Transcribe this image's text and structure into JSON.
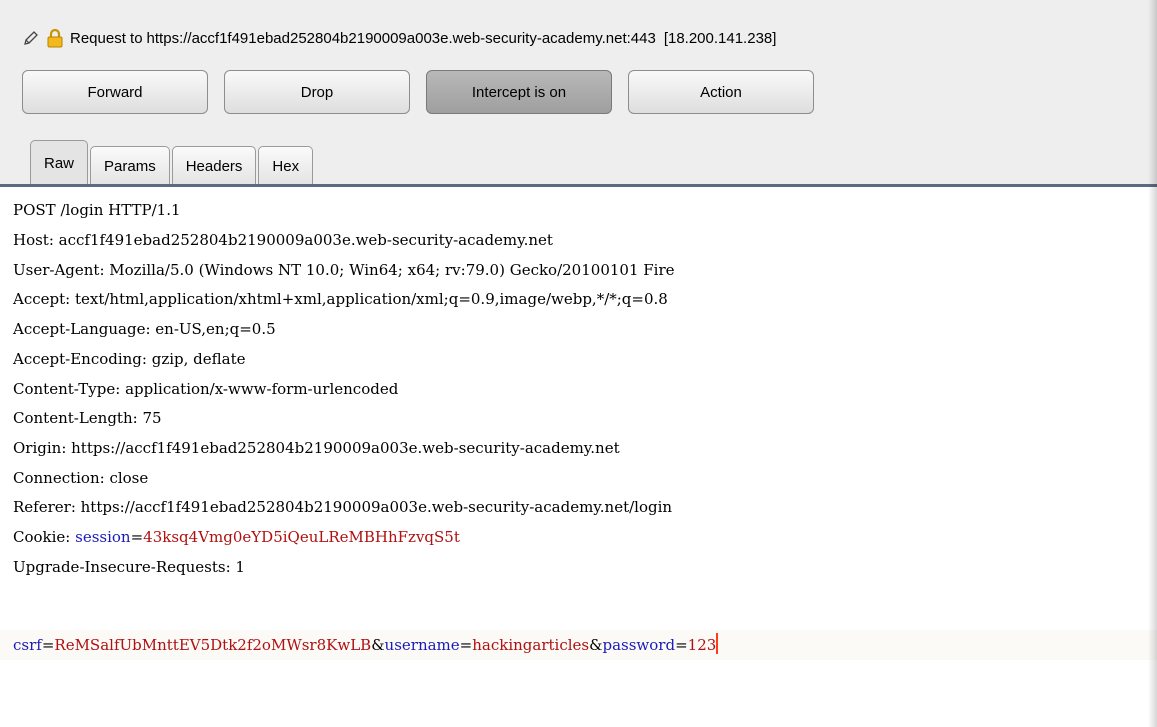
{
  "header": {
    "request_label": "Request to",
    "url": "https://accf1f491ebad252804b2190009a003e.web-security-academy.net:443",
    "ip": "[18.200.141.238]",
    "icons": [
      "pencil-icon",
      "lock-icon"
    ]
  },
  "buttons": {
    "forward": "Forward",
    "drop": "Drop",
    "intercept": "Intercept is on",
    "action": "Action"
  },
  "tabs": [
    {
      "label": "Raw",
      "active": true
    },
    {
      "label": "Params",
      "active": false
    },
    {
      "label": "Headers",
      "active": false
    },
    {
      "label": "Hex",
      "active": false
    }
  ],
  "request": {
    "lines": [
      "POST /login HTTP/1.1",
      "Host: accf1f491ebad252804b2190009a003e.web-security-academy.net",
      "User-Agent: Mozilla/5.0 (Windows NT 10.0; Win64; x64; rv:79.0) Gecko/20100101 Fire",
      "Accept: text/html,application/xhtml+xml,application/xml;q=0.9,image/webp,*/*;q=0.8",
      "Accept-Language: en-US,en;q=0.5",
      "Accept-Encoding: gzip, deflate",
      "Content-Type: application/x-www-form-urlencoded",
      "Content-Length: 75",
      "Origin: https://accf1f491ebad252804b2190009a003e.web-security-academy.net",
      "Connection: close",
      "Referer: https://accf1f491ebad252804b2190009a003e.web-security-academy.net/login"
    ],
    "cookie": {
      "label": "Cookie: ",
      "name": "session",
      "eq": "=",
      "value": "43ksq4Vmg0eYD5iQeuLReMBHhFzvqS5t"
    },
    "upgrade": "Upgrade-Insecure-Requests: 1",
    "body": {
      "k1": "csrf",
      "v1": "ReMSalfUbMnttEV5Dtk2f2oMWsr8KwLB",
      "amp": "&",
      "k2": "username",
      "v2": "hackingarticles",
      "k3": "password",
      "v3": "123",
      "eq": "="
    }
  },
  "colors": {
    "param_name": "#1a1ab8",
    "param_value": "#b01010",
    "caret": "#ff3b1a",
    "tab_rule": "#5d6a82"
  }
}
